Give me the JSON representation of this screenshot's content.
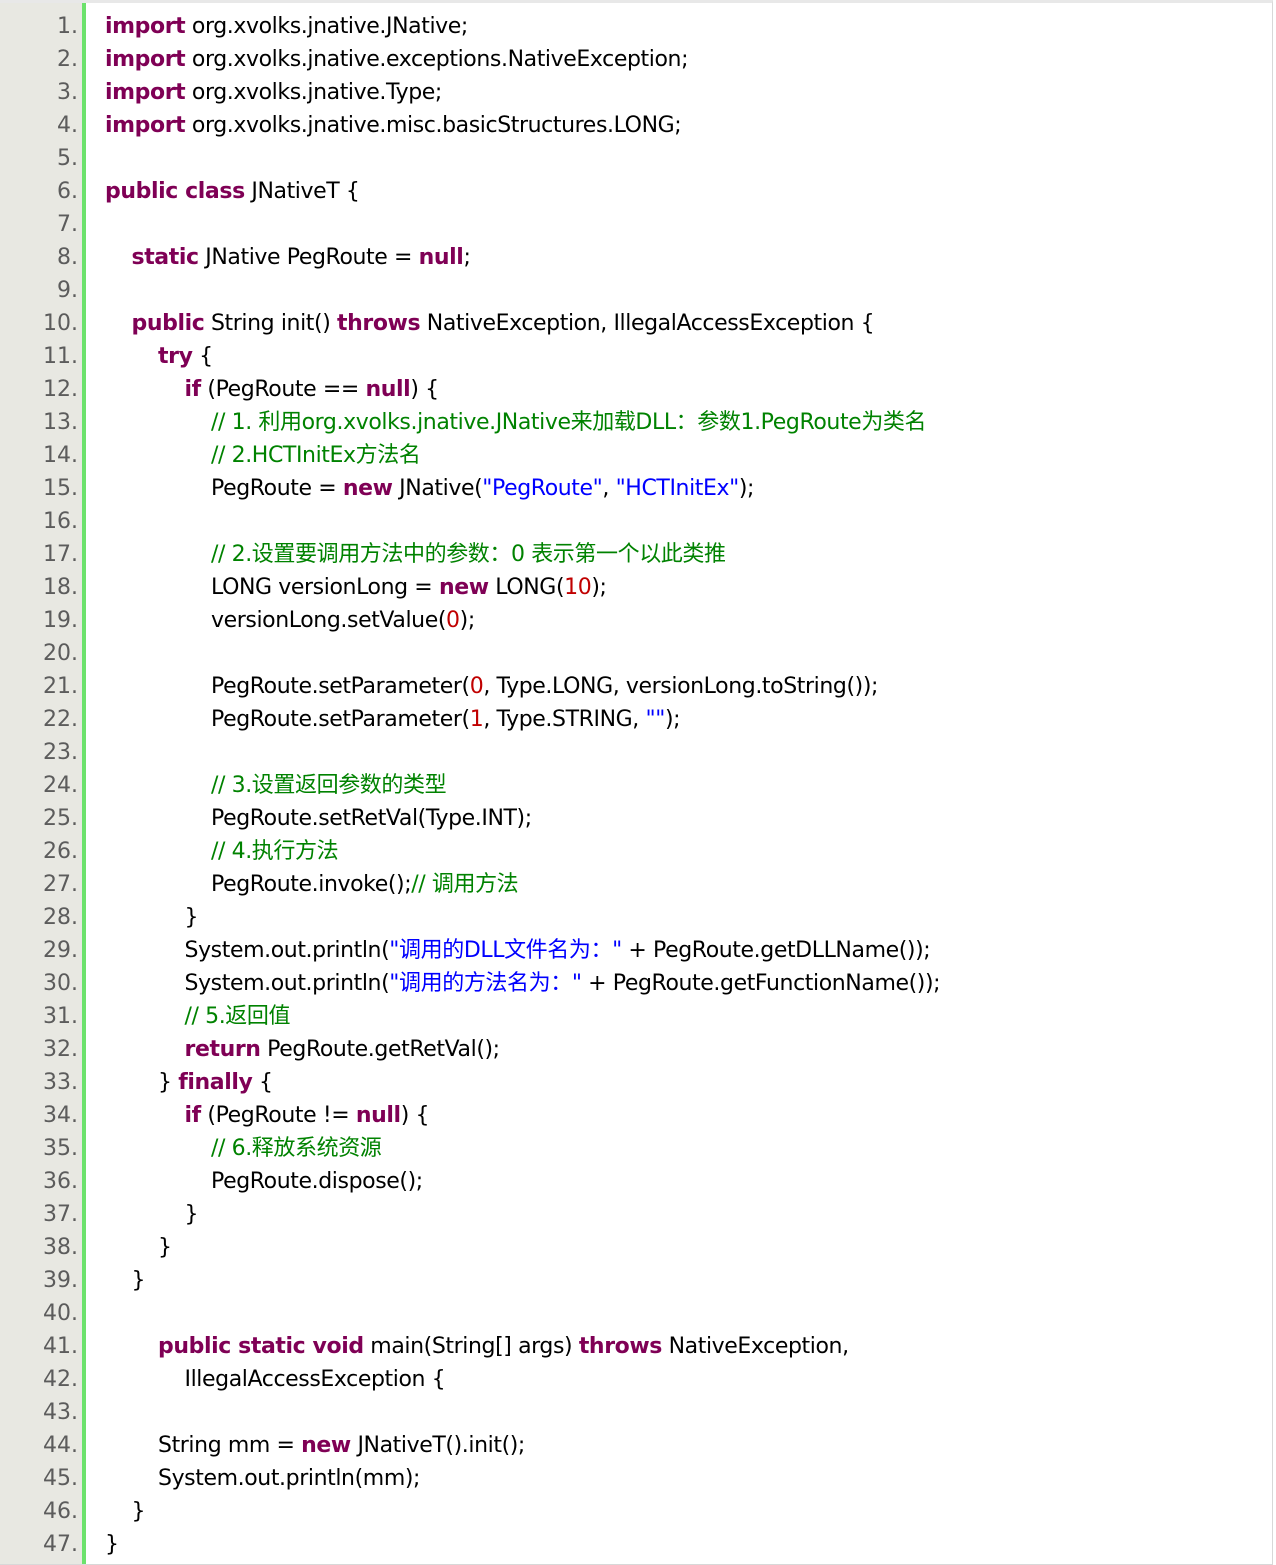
{
  "colors": {
    "keyword": "#7f0055",
    "comment": "#008200",
    "string": "#0000ff",
    "number": "#c00000",
    "plain": "#000000",
    "gutter_bg": "#e8e8e2",
    "gutter_rule": "#6ce26c",
    "line_number": "#5c5c5c"
  },
  "lines": [
    {
      "n": "1.",
      "indent": 0,
      "tokens": [
        {
          "t": "import",
          "c": "kw"
        },
        {
          "t": " org.xvolks.jnative.JNative;",
          "c": ""
        }
      ]
    },
    {
      "n": "2.",
      "indent": 0,
      "tokens": [
        {
          "t": "import",
          "c": "kw"
        },
        {
          "t": " org.xvolks.jnative.exceptions.NativeException;",
          "c": ""
        }
      ]
    },
    {
      "n": "3.",
      "indent": 0,
      "tokens": [
        {
          "t": "import",
          "c": "kw"
        },
        {
          "t": " org.xvolks.jnative.Type;",
          "c": ""
        }
      ]
    },
    {
      "n": "4.",
      "indent": 0,
      "tokens": [
        {
          "t": "import",
          "c": "kw"
        },
        {
          "t": " org.xvolks.jnative.misc.basicStructures.LONG;",
          "c": ""
        }
      ]
    },
    {
      "n": "5.",
      "indent": 0,
      "tokens": []
    },
    {
      "n": "6.",
      "indent": 0,
      "tokens": [
        {
          "t": "public class",
          "c": "kw"
        },
        {
          "t": " JNativeT {",
          "c": ""
        }
      ]
    },
    {
      "n": "7.",
      "indent": 0,
      "tokens": []
    },
    {
      "n": "8.",
      "indent": 1,
      "tokens": [
        {
          "t": "static",
          "c": "kw"
        },
        {
          "t": " JNative PegRoute = ",
          "c": ""
        },
        {
          "t": "null",
          "c": "kw"
        },
        {
          "t": ";",
          "c": ""
        }
      ]
    },
    {
      "n": "9.",
      "indent": 0,
      "tokens": []
    },
    {
      "n": "10.",
      "indent": 1,
      "tokens": [
        {
          "t": "public",
          "c": "kw"
        },
        {
          "t": " String init() ",
          "c": ""
        },
        {
          "t": "throws",
          "c": "kw"
        },
        {
          "t": " NativeException, IllegalAccessException {",
          "c": ""
        }
      ]
    },
    {
      "n": "11.",
      "indent": 2,
      "tokens": [
        {
          "t": "try",
          "c": "kw"
        },
        {
          "t": " {",
          "c": ""
        }
      ]
    },
    {
      "n": "12.",
      "indent": 3,
      "tokens": [
        {
          "t": "if",
          "c": "kw"
        },
        {
          "t": " (PegRoute == ",
          "c": ""
        },
        {
          "t": "null",
          "c": "kw"
        },
        {
          "t": ") {",
          "c": ""
        }
      ]
    },
    {
      "n": "13.",
      "indent": 4,
      "tokens": [
        {
          "t": "// 1. 利用org.xvolks.jnative.JNative来加载DLL：参数1.PegRoute为类名",
          "c": "cm"
        }
      ]
    },
    {
      "n": "14.",
      "indent": 4,
      "tokens": [
        {
          "t": "// 2.HCTInitEx方法名",
          "c": "cm"
        }
      ]
    },
    {
      "n": "15.",
      "indent": 4,
      "tokens": [
        {
          "t": "PegRoute = ",
          "c": ""
        },
        {
          "t": "new",
          "c": "kw"
        },
        {
          "t": " JNative(",
          "c": ""
        },
        {
          "t": "\"PegRoute\"",
          "c": "st"
        },
        {
          "t": ", ",
          "c": ""
        },
        {
          "t": "\"HCTInitEx\"",
          "c": "st"
        },
        {
          "t": ");",
          "c": ""
        }
      ]
    },
    {
      "n": "16.",
      "indent": 0,
      "tokens": []
    },
    {
      "n": "17.",
      "indent": 4,
      "tokens": [
        {
          "t": "// 2.设置要调用方法中的参数：0 表示第一个以此类推",
          "c": "cm"
        }
      ]
    },
    {
      "n": "18.",
      "indent": 4,
      "tokens": [
        {
          "t": "LONG versionLong = ",
          "c": ""
        },
        {
          "t": "new",
          "c": "kw"
        },
        {
          "t": " LONG(",
          "c": ""
        },
        {
          "t": "10",
          "c": "nm"
        },
        {
          "t": ");",
          "c": ""
        }
      ]
    },
    {
      "n": "19.",
      "indent": 4,
      "tokens": [
        {
          "t": "versionLong.setValue(",
          "c": ""
        },
        {
          "t": "0",
          "c": "nm"
        },
        {
          "t": ");",
          "c": ""
        }
      ]
    },
    {
      "n": "20.",
      "indent": 0,
      "tokens": []
    },
    {
      "n": "21.",
      "indent": 4,
      "tokens": [
        {
          "t": "PegRoute.setParameter(",
          "c": ""
        },
        {
          "t": "0",
          "c": "nm"
        },
        {
          "t": ", Type.LONG, versionLong.toString());",
          "c": ""
        }
      ]
    },
    {
      "n": "22.",
      "indent": 4,
      "tokens": [
        {
          "t": "PegRoute.setParameter(",
          "c": ""
        },
        {
          "t": "1",
          "c": "nm"
        },
        {
          "t": ", Type.STRING, ",
          "c": ""
        },
        {
          "t": "\"\"",
          "c": "st"
        },
        {
          "t": ");",
          "c": ""
        }
      ]
    },
    {
      "n": "23.",
      "indent": 0,
      "tokens": []
    },
    {
      "n": "24.",
      "indent": 4,
      "tokens": [
        {
          "t": "// 3.设置返回参数的类型",
          "c": "cm"
        }
      ]
    },
    {
      "n": "25.",
      "indent": 4,
      "tokens": [
        {
          "t": "PegRoute.setRetVal(Type.INT);",
          "c": ""
        }
      ]
    },
    {
      "n": "26.",
      "indent": 4,
      "tokens": [
        {
          "t": "// 4.执行方法",
          "c": "cm"
        }
      ]
    },
    {
      "n": "27.",
      "indent": 4,
      "tokens": [
        {
          "t": "PegRoute.invoke();",
          "c": ""
        },
        {
          "t": "// 调用方法",
          "c": "cm"
        }
      ]
    },
    {
      "n": "28.",
      "indent": 3,
      "tokens": [
        {
          "t": "}",
          "c": ""
        }
      ]
    },
    {
      "n": "29.",
      "indent": 3,
      "tokens": [
        {
          "t": "System.out.println(",
          "c": ""
        },
        {
          "t": "\"调用的DLL文件名为：\"",
          "c": "st"
        },
        {
          "t": " + PegRoute.getDLLName());",
          "c": ""
        }
      ]
    },
    {
      "n": "30.",
      "indent": 3,
      "tokens": [
        {
          "t": "System.out.println(",
          "c": ""
        },
        {
          "t": "\"调用的方法名为：\"",
          "c": "st"
        },
        {
          "t": " + PegRoute.getFunctionName());",
          "c": ""
        }
      ]
    },
    {
      "n": "31.",
      "indent": 3,
      "tokens": [
        {
          "t": "// 5.返回值",
          "c": "cm"
        }
      ]
    },
    {
      "n": "32.",
      "indent": 3,
      "tokens": [
        {
          "t": "return",
          "c": "kw"
        },
        {
          "t": " PegRoute.getRetVal();",
          "c": ""
        }
      ]
    },
    {
      "n": "33.",
      "indent": 2,
      "tokens": [
        {
          "t": "} ",
          "c": ""
        },
        {
          "t": "finally",
          "c": "kw"
        },
        {
          "t": " {",
          "c": ""
        }
      ]
    },
    {
      "n": "34.",
      "indent": 3,
      "tokens": [
        {
          "t": "if",
          "c": "kw"
        },
        {
          "t": " (PegRoute != ",
          "c": ""
        },
        {
          "t": "null",
          "c": "kw"
        },
        {
          "t": ") {",
          "c": ""
        }
      ]
    },
    {
      "n": "35.",
      "indent": 4,
      "tokens": [
        {
          "t": "// 6.释放系统资源",
          "c": "cm"
        }
      ]
    },
    {
      "n": "36.",
      "indent": 4,
      "tokens": [
        {
          "t": "PegRoute.dispose();",
          "c": ""
        }
      ]
    },
    {
      "n": "37.",
      "indent": 3,
      "tokens": [
        {
          "t": "}",
          "c": ""
        }
      ]
    },
    {
      "n": "38.",
      "indent": 2,
      "tokens": [
        {
          "t": "}",
          "c": ""
        }
      ]
    },
    {
      "n": "39.",
      "indent": 1,
      "tokens": [
        {
          "t": "}",
          "c": ""
        }
      ]
    },
    {
      "n": "40.",
      "indent": 0,
      "tokens": []
    },
    {
      "n": "41.",
      "indent": 2,
      "tokens": [
        {
          "t": "public static void",
          "c": "kw"
        },
        {
          "t": " main(String[] args) ",
          "c": ""
        },
        {
          "t": "throws",
          "c": "kw"
        },
        {
          "t": " NativeException,",
          "c": ""
        }
      ]
    },
    {
      "n": "42.",
      "indent": 3,
      "tokens": [
        {
          "t": "IllegalAccessException {",
          "c": ""
        }
      ]
    },
    {
      "n": "43.",
      "indent": 0,
      "tokens": []
    },
    {
      "n": "44.",
      "indent": 2,
      "tokens": [
        {
          "t": "String mm = ",
          "c": ""
        },
        {
          "t": "new",
          "c": "kw"
        },
        {
          "t": " JNativeT().init();",
          "c": ""
        }
      ]
    },
    {
      "n": "45.",
      "indent": 2,
      "tokens": [
        {
          "t": "System.out.println(mm);",
          "c": ""
        }
      ]
    },
    {
      "n": "46.",
      "indent": 1,
      "tokens": [
        {
          "t": "}",
          "c": ""
        }
      ]
    },
    {
      "n": "47.",
      "indent": 0,
      "tokens": [
        {
          "t": "}",
          "c": ""
        }
      ]
    }
  ]
}
